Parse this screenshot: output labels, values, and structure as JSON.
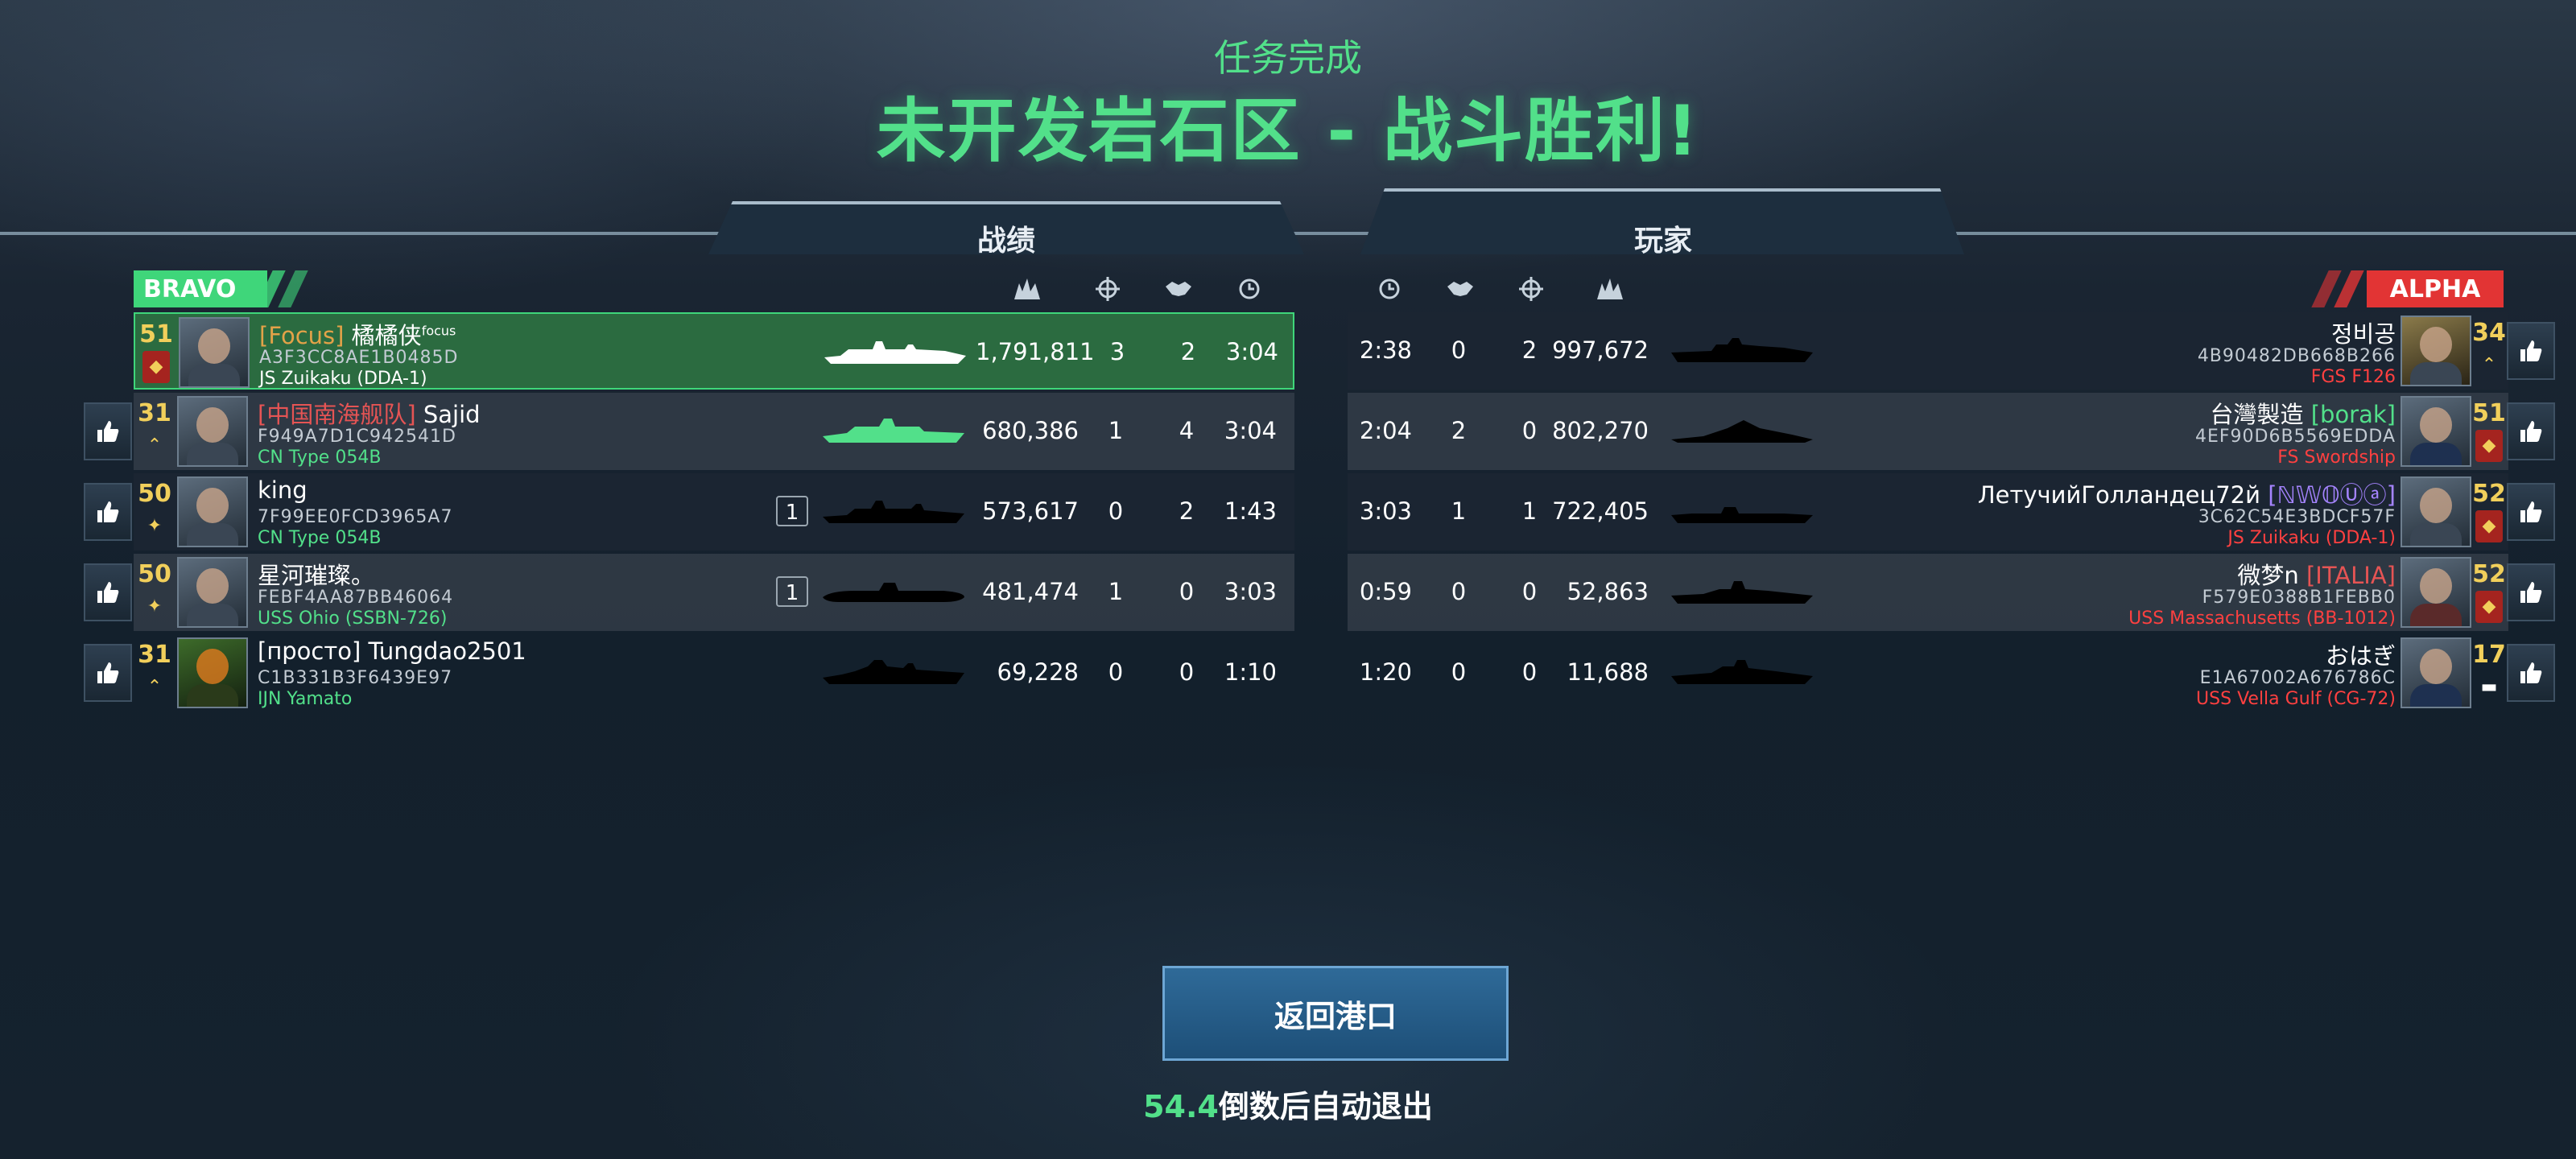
{
  "header": {
    "subtitle": "任务完成",
    "title": "未开发岩石区 - 战斗胜利!"
  },
  "tabs": {
    "left": "战绩",
    "right": "玩家"
  },
  "teams": {
    "left": {
      "name": "BRAVO",
      "color": "#3fd67a"
    },
    "right": {
      "name": "ALPHA",
      "color": "#e23434"
    }
  },
  "columns": {
    "left": [
      "damage-icon",
      "crosshair-icon",
      "handshake-icon",
      "clock-icon"
    ],
    "right": [
      "clock-icon",
      "handshake-icon",
      "crosshair-icon",
      "damage-icon"
    ]
  },
  "left_rows": [
    {
      "level": "51",
      "tag": "[Focus]",
      "name": "橘橘侠",
      "sup": "focus",
      "id": "A3F3CC8AE1B0485D",
      "ship": "JS Zuikaku (DDA-1)",
      "kills": "",
      "damage": "1,791,811",
      "c1": "3",
      "c2": "2",
      "time": "3:04",
      "highlight": true,
      "ship_color": "white",
      "sil_color": "#ffffff"
    },
    {
      "level": "31",
      "tag": "[中国南海舰队]",
      "name": " Sajid",
      "sup": "",
      "id": "F949A7D1C942541D",
      "ship": "CN Type 054B",
      "kills": "",
      "damage": "680,386",
      "c1": "1",
      "c2": "4",
      "time": "3:04",
      "highlight": false,
      "ship_color": "green",
      "sil_color": "#52e08a"
    },
    {
      "level": "50",
      "tag": "",
      "name": "king",
      "sup": "",
      "id": "7F99EE0FCD3965A7",
      "ship": "CN Type 054B",
      "kills": "1",
      "damage": "573,617",
      "c1": "0",
      "c2": "2",
      "time": "1:43",
      "highlight": false,
      "ship_color": "green",
      "sil_color": "#000000"
    },
    {
      "level": "50",
      "tag": "",
      "name": "星河璀璨。",
      "sup": "",
      "id": "FEBF4AA87BB46064",
      "ship": "USS Ohio (SSBN-726)",
      "kills": "1",
      "damage": "481,474",
      "c1": "1",
      "c2": "0",
      "time": "3:03",
      "highlight": false,
      "ship_color": "green",
      "sil_color": "#000000"
    },
    {
      "level": "31",
      "tag": "",
      "name": "[просто] Tungdao2501",
      "sup": "",
      "id": "C1B331B3F6439E97",
      "ship": "IJN Yamato",
      "kills": "",
      "damage": "69,228",
      "c1": "0",
      "c2": "0",
      "time": "1:10",
      "highlight": false,
      "ship_color": "green",
      "sil_color": "#000000"
    }
  ],
  "right_rows": [
    {
      "level": "34",
      "name": "정비공",
      "tag": "",
      "id": "4B90482DB668B266",
      "ship": "FGS F126",
      "time": "2:38",
      "c1": "0",
      "c2": "2",
      "damage": "997,672"
    },
    {
      "level": "51",
      "name": "台灣製造 ",
      "tag": "[borak]",
      "id": "4EF90D6B5569EDDA",
      "ship": "FS Swordship",
      "time": "2:04",
      "c1": "2",
      "c2": "0",
      "damage": "802,270"
    },
    {
      "level": "52",
      "name": "ЛетучийГолландец72й ",
      "tag": "[ℕ𝕎𝕆Ⓤⓐ]",
      "id": "3C62C54E3BDCF57F",
      "ship": "JS Zuikaku (DDA-1)",
      "time": "3:03",
      "c1": "1",
      "c2": "1",
      "damage": "722,405"
    },
    {
      "level": "52",
      "name": "微梦n ",
      "tag": "[ITALIA]",
      "id": "F579E0388B1FEBB0",
      "ship": "USS Massachusetts (BB-1012)",
      "time": "0:59",
      "c1": "0",
      "c2": "0",
      "damage": "52,863"
    },
    {
      "level": "17",
      "name": "おはぎ",
      "tag": "",
      "id": "E1A67002A676786C",
      "ship": "USS Vella Gulf (CG-72)",
      "time": "1:20",
      "c1": "0",
      "c2": "0",
      "damage": "11,688"
    }
  ],
  "footer": {
    "return_label": "返回港口",
    "countdown_value": "54.4",
    "countdown_text": "倒数后自动退出"
  }
}
